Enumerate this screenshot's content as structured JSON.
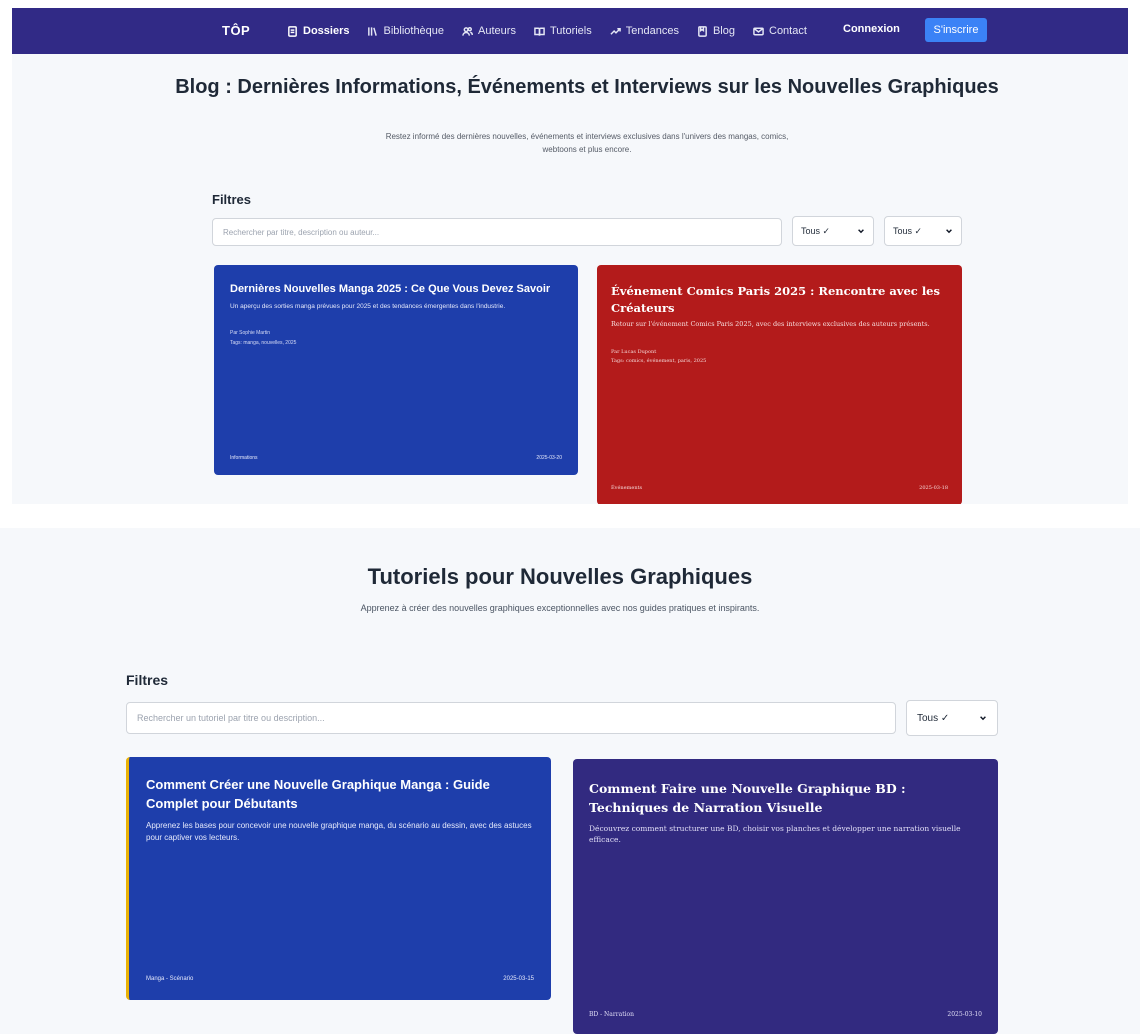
{
  "nav": {
    "logo": "TÔP",
    "items": [
      {
        "label": "Dossiers",
        "icon": "file-icon"
      },
      {
        "label": "Bibliothèque",
        "icon": "library-icon"
      },
      {
        "label": "Auteurs",
        "icon": "users-icon"
      },
      {
        "label": "Tutoriels",
        "icon": "book-open-icon"
      },
      {
        "label": "Tendances",
        "icon": "trending-icon"
      },
      {
        "label": "Blog",
        "icon": "bookmark-icon"
      },
      {
        "label": "Contact",
        "icon": "mail-icon"
      }
    ],
    "login_label": "Connexion",
    "signup_label": "S'inscrire",
    "colors": {
      "bar": "#312a86",
      "signup": "#3b82f6"
    }
  },
  "blog": {
    "title": "Blog : Dernières Informations, Événements et Interviews sur les Nouvelles Graphiques",
    "subtitle": "Restez informé des dernières nouvelles, événements et interviews exclusives dans l'univers des mangas, comics, webtoons et plus encore.",
    "filters_label": "Filtres",
    "search_placeholder": "Rechercher par titre, description ou auteur...",
    "filter_category": "Tous ✓",
    "filter_sort": "Tous ✓",
    "posts": [
      {
        "title": "Dernières Nouvelles Manga 2025 : Ce Que Vous Devez Savoir",
        "description": "Un aperçu des sorties manga prévues pour 2025 et des tendances émergentes dans l'industrie.",
        "author": "Par Sophie Martin",
        "tags": "Tags: manga, nouvelles, 2025",
        "category": "Informations",
        "date": "2025-03-20",
        "color": "#1e3eab"
      },
      {
        "title": "Événement Comics Paris 2025 : Rencontre avec les Créateurs",
        "description": "Retour sur l'événement Comics Paris 2025, avec des interviews exclusives des auteurs présents.",
        "author": "Par Lucas Dupont",
        "tags": "Tags: comics, événement, paris, 2025",
        "category": "Événements",
        "date": "2025-03-18",
        "color": "#b31b1b"
      }
    ]
  },
  "tutorials": {
    "title": "Tutoriels pour Nouvelles Graphiques",
    "subtitle": "Apprenez à créer des nouvelles graphiques exceptionnelles avec nos guides pratiques et inspirants.",
    "filters_label": "Filtres",
    "search_placeholder": "Rechercher un tutoriel par titre ou description...",
    "filter_category": "Tous ✓",
    "items": [
      {
        "title": "Comment Créer une Nouvelle Graphique Manga : Guide Complet pour Débutants",
        "description": "Apprenez les bases pour concevoir une nouvelle graphique manga, du scénario au dessin, avec des astuces pour captiver vos lecteurs.",
        "category": "Manga - Scénario",
        "date": "2025-03-15",
        "color": "#1e3eab",
        "accent": "#eab308"
      },
      {
        "title": "Comment Faire une Nouvelle Graphique BD : Techniques de Narration Visuelle",
        "description": "Découvrez comment structurer une BD, choisir vos planches et développer une narration visuelle efficace.",
        "category": "BD - Narration",
        "date": "2025-03-10",
        "color": "#322a80"
      }
    ]
  }
}
